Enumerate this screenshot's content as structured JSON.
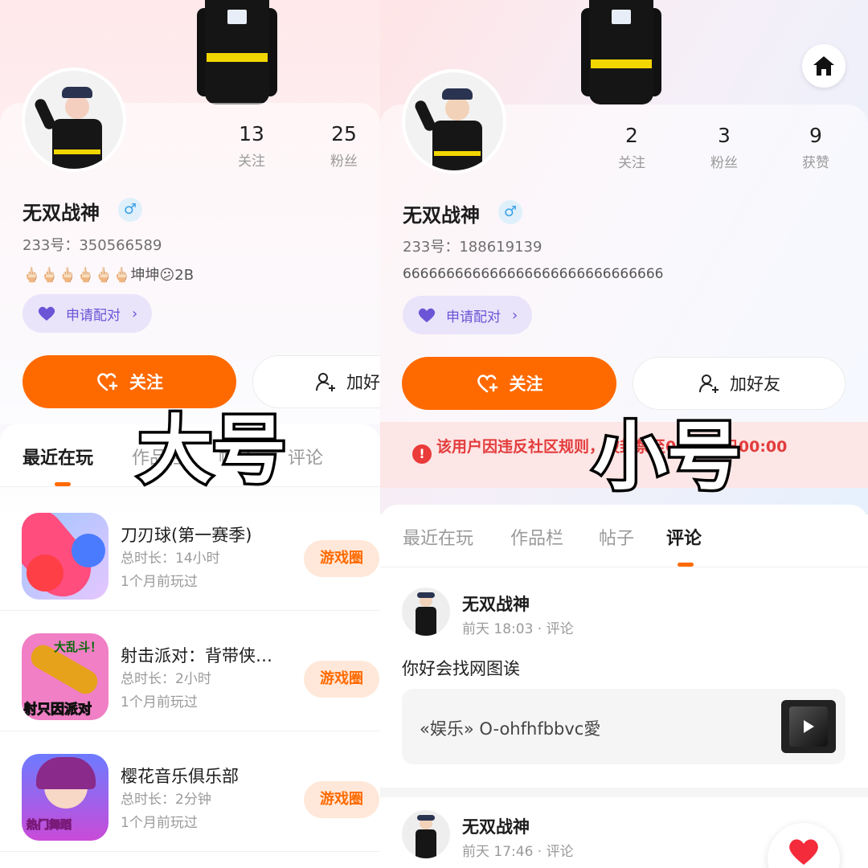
{
  "left": {
    "stats": [
      {
        "num": "13",
        "label": "关注"
      },
      {
        "num": "25",
        "label": "粉丝"
      }
    ],
    "name": "无双战神",
    "gender": "♂",
    "uid": "233号：350566589",
    "bio": "🖕🏻🖕🏻🖕🏻🖕🏻🖕🏻🖕🏻坤坤😕2B",
    "pair_label": "申请配对",
    "follow_label": "关注",
    "friend_label": "加好",
    "tabs": [
      "最近在玩",
      "作品栏",
      "帖子",
      "评论"
    ],
    "overlay": "大号",
    "games": [
      {
        "title": "刀刃球(第一赛季)",
        "duration": "总时长：14小时",
        "last": "1个月前玩过",
        "circle": "游戏圈"
      },
      {
        "title": "射击派对：背带侠…",
        "duration": "总时长：2小时",
        "last": "1个月前玩过",
        "circle": "游戏圈",
        "icon_text_1": "大乱斗！",
        "icon_text_2": "射只因派对"
      },
      {
        "title": "樱花音乐俱乐部",
        "duration": "总时长：2分钟",
        "last": "1个月前玩过",
        "circle": "游戏圈",
        "icon_text": "热门舞蹈"
      }
    ]
  },
  "right": {
    "stats": [
      {
        "num": "2",
        "label": "关注"
      },
      {
        "num": "3",
        "label": "粉丝"
      },
      {
        "num": "9",
        "label": "获赞"
      }
    ],
    "name": "无双战神",
    "gender": "♂",
    "uid": "233号：188619139",
    "bio": "666666666666666666666666666666",
    "pair_label": "申请配对",
    "follow_label": "关注",
    "friend_label": "加好友",
    "ban_text": "该用户因违反社区规则，被封禁至04月30日00:00",
    "tabs": [
      "最近在玩",
      "作品栏",
      "帖子",
      "评论"
    ],
    "overlay": "小号",
    "comments": [
      {
        "name": "无双战神",
        "meta": "前天 18:03 · 评论",
        "text": "你好会找网图诶",
        "ref": "«娱乐» O-ohfhfbbvc愛"
      },
      {
        "name": "无双战神",
        "meta": "前天 17:46 · 评论"
      }
    ]
  },
  "colors": {
    "accent": "#ff6a00",
    "pair": "#6b55d6",
    "ban": "#e33c3c"
  },
  "icons": [
    "heart-plus-icon",
    "add-friend-icon",
    "home-icon",
    "chevron-right-icon",
    "warning-icon",
    "play-icon",
    "heart-icon"
  ]
}
